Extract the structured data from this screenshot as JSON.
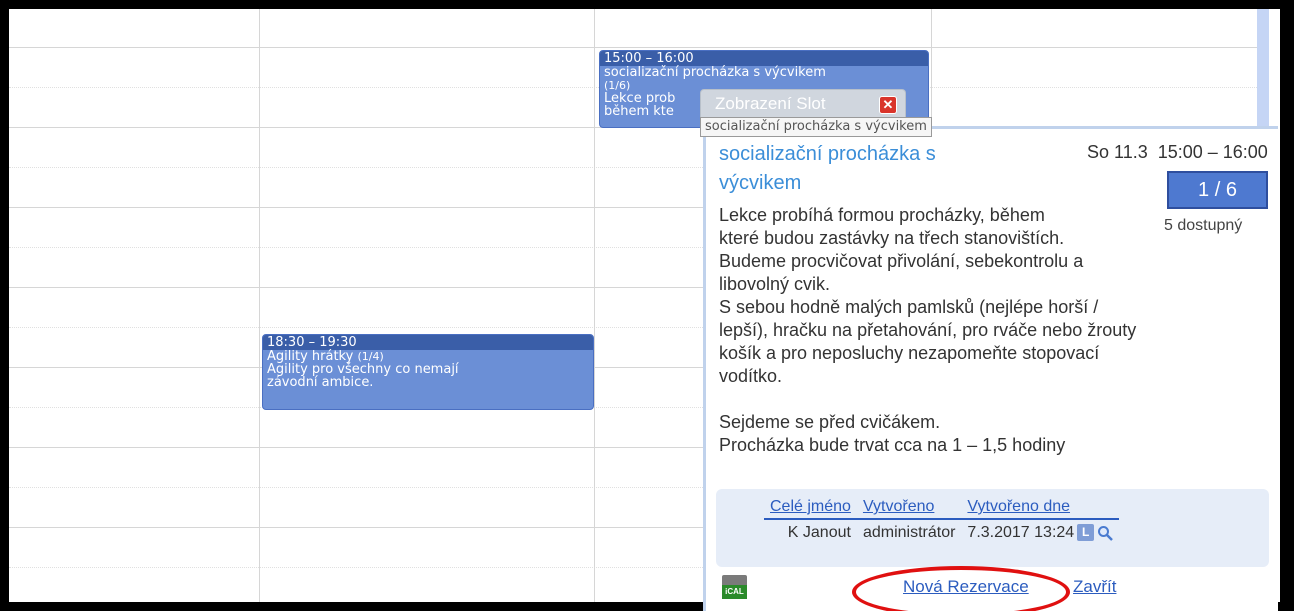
{
  "calendar": {
    "events": [
      {
        "time": "15:00 – 16:00",
        "title": "socializační procházka s výcvikem",
        "count": "(1/6)",
        "desc": "Lekce prob",
        "desc2": "během kte"
      },
      {
        "time": "18:30 – 19:30",
        "title": "Agility hrátky",
        "count": "(1/4)",
        "desc": "Agility pro všechny co nemají",
        "desc2": "závodní ambice."
      }
    ]
  },
  "tab": {
    "label": "Zobrazení Slot",
    "close_icon": "close-icon"
  },
  "tooltip": "socializační procházka s výcvikem",
  "popup": {
    "title_line1": "socializační procházka s",
    "title_line2": "výcvikem",
    "when": "So 11.3  15:00 – 16:00",
    "capacity": "1 / 6",
    "available": "5 dostupný",
    "description": [
      "Lekce probíhá formou procházky, během",
      "které budou zastávky na třech stanovištích.",
      "Budeme procvičovat přivolání, sebekontrolu a",
      "libovolný cvik.",
      "S sebou hodně malých pamlsků (nejlépe horší /",
      "lepší), hračku na přetahování, pro rváče nebo žrouty",
      "košík a pro neposluchy nezapomeňte stopovací",
      "vodítko.",
      "",
      "Sejdeme se před cvičákem.",
      "Procházka bude trvat cca na 1 – 1,5 hodiny"
    ],
    "table": {
      "headers": [
        "Celé jméno",
        "Vytvořeno",
        "Vytvořeno dne"
      ],
      "row": [
        "K Janout",
        "administrátor",
        "7.3.2017 13:24"
      ],
      "badge": "L"
    },
    "ical_label": "iCAL",
    "new_reservation": "Nová Rezervace",
    "close": "Zavřít"
  }
}
